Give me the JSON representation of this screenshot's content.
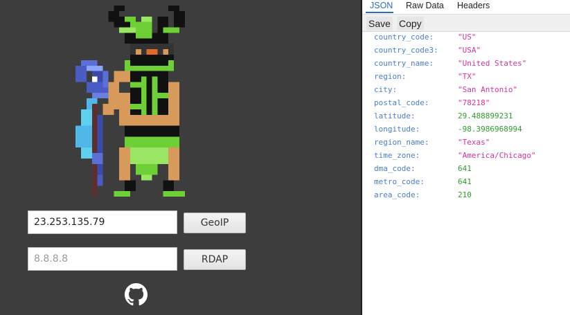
{
  "left": {
    "ip_input": {
      "value": "23.253.135.79"
    },
    "geoip_button": "GeoIP",
    "rdap_input": {
      "placeholder": "8.8.8.8"
    },
    "rdap_button": "RDAP",
    "icons": {
      "mascot": "pixel-art-character",
      "github": "github-icon"
    }
  },
  "tabs": [
    "JSON",
    "Raw Data",
    "Headers"
  ],
  "toolbar": {
    "save": "Save",
    "copy": "Copy"
  },
  "json_rows": [
    {
      "key": "country_code:",
      "value": "\"US\"",
      "type": "str"
    },
    {
      "key": "country_code3:",
      "value": "\"USA\"",
      "type": "str"
    },
    {
      "key": "country_name:",
      "value": "\"United States\"",
      "type": "str"
    },
    {
      "key": "region:",
      "value": "\"TX\"",
      "type": "str"
    },
    {
      "key": "city:",
      "value": "\"San Antonio\"",
      "type": "str"
    },
    {
      "key": "postal_code:",
      "value": "\"78218\"",
      "type": "str"
    },
    {
      "key": "latitude:",
      "value": "29.488899231",
      "type": "num"
    },
    {
      "key": "longitude:",
      "value": "-98.3986968994",
      "type": "num"
    },
    {
      "key": "region_name:",
      "value": "\"Texas\"",
      "type": "str"
    },
    {
      "key": "time_zone:",
      "value": "\"America/Chicago\"",
      "type": "str"
    },
    {
      "key": "dma_code:",
      "value": "641",
      "type": "num"
    },
    {
      "key": "metro_code:",
      "value": "641",
      "type": "num"
    },
    {
      "key": "area_code:",
      "value": "210",
      "type": "num"
    }
  ],
  "colors": {
    "left_bg": "#3d3d3d",
    "tab_active": "#2a6ec4",
    "json_key": "#4a7ec7",
    "json_string": "#d5329c",
    "json_number": "#2f9b2f"
  }
}
